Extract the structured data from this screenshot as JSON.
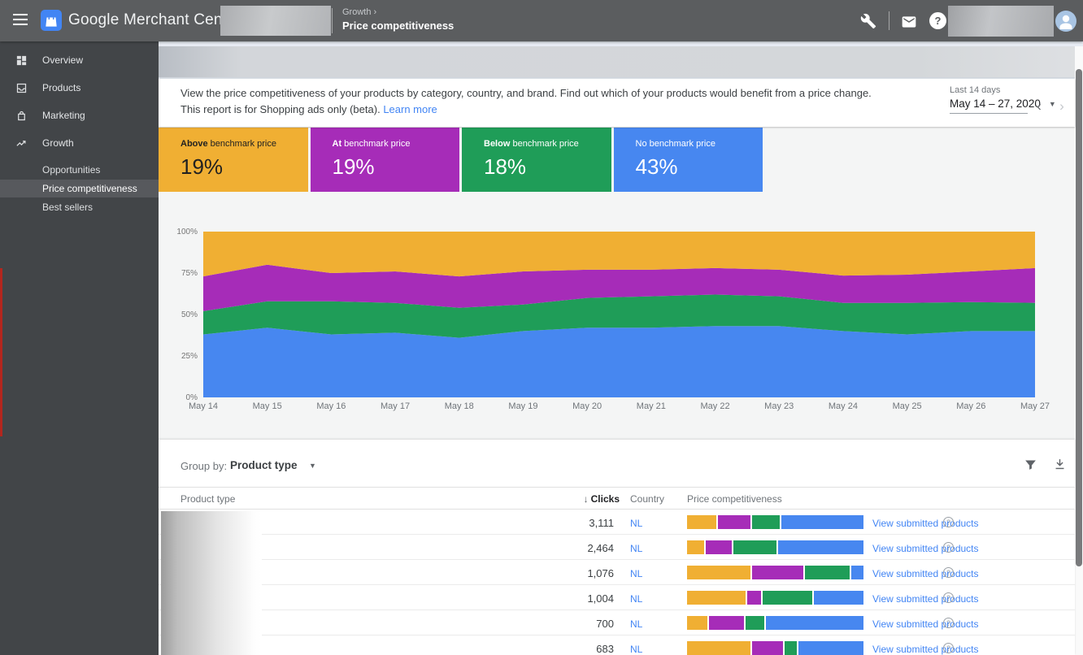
{
  "topbar": {
    "app_title": "Google Merchant Center",
    "breadcrumb": {
      "section": "Growth ›",
      "page": "Price competitiveness"
    }
  },
  "sidebar": {
    "items": [
      {
        "label": "Overview",
        "icon": "dashboard"
      },
      {
        "label": "Products",
        "icon": "products"
      },
      {
        "label": "Marketing",
        "icon": "marketing"
      },
      {
        "label": "Growth",
        "icon": "growth"
      }
    ],
    "sub_items": [
      {
        "label": "Opportunities",
        "selected": false
      },
      {
        "label": "Price competitiveness",
        "selected": true
      },
      {
        "label": "Best sellers",
        "selected": false
      }
    ]
  },
  "intro": {
    "line1": "View the price competitiveness of your products by category, country, and brand. Find out which of your products would benefit from a price change.",
    "line2": "This report is for Shopping ads only (beta).",
    "learn_more_label": "Learn more"
  },
  "date_picker": {
    "label": "Last 14 days",
    "value": "May 14 – 27, 2020"
  },
  "summary_cards": [
    {
      "emphasis": "Above",
      "rest": " benchmark price",
      "value": "19%",
      "color": "#F0AF33",
      "text": "dark"
    },
    {
      "emphasis": "At",
      "rest": " benchmark price",
      "value": "19%",
      "color": "#A62CB8",
      "text": "light"
    },
    {
      "emphasis": "Below",
      "rest": " benchmark price",
      "value": "18%",
      "color": "#1F9D58",
      "text": "light"
    },
    {
      "emphasis": "",
      "rest": "No benchmark price",
      "value": "43%",
      "color": "#4787F0",
      "text": "light"
    }
  ],
  "colors": {
    "above": "#F0AF33",
    "at": "#A62CB8",
    "below": "#1F9D58",
    "no_benchmark": "#4787F0"
  },
  "chart_data": {
    "type": "area",
    "stacked": true,
    "unit": "percent",
    "x": [
      "May 14",
      "May 15",
      "May 16",
      "May 17",
      "May 18",
      "May 19",
      "May 20",
      "May 21",
      "May 22",
      "May 23",
      "May 24",
      "May 25",
      "May 26",
      "May 27"
    ],
    "ylim": [
      0,
      100
    ],
    "yticks": [
      "0%",
      "25%",
      "50%",
      "75%",
      "100%"
    ],
    "grid": false,
    "legend": "none",
    "series": [
      {
        "name": "No benchmark price",
        "color_key": "no_benchmark",
        "values": [
          38,
          42,
          38,
          39,
          36,
          40,
          42,
          42,
          43,
          43,
          40,
          38,
          40,
          40
        ]
      },
      {
        "name": "Below benchmark price",
        "color_key": "below",
        "values": [
          14,
          16,
          20,
          18,
          18,
          16,
          18,
          19,
          19,
          18,
          17,
          19,
          17.5,
          17
        ]
      },
      {
        "name": "At benchmark price",
        "color_key": "at",
        "values": [
          21,
          22,
          17,
          19,
          19,
          20,
          17,
          16,
          16,
          16,
          16.5,
          17,
          18.5,
          21
        ]
      },
      {
        "name": "Above benchmark price",
        "color_key": "above",
        "values": [
          27,
          20,
          25,
          24,
          27,
          24,
          23,
          23,
          22,
          23,
          26.5,
          26,
          24,
          22
        ]
      }
    ]
  },
  "table": {
    "group_by_label": "Group by:",
    "group_by_value": "Product type",
    "columns": {
      "product_type": "Product type",
      "clicks": "Clicks",
      "country": "Country",
      "price_competitiveness": "Price competitiveness"
    },
    "sorted_by": "Clicks",
    "sort_direction": "descending",
    "action_label": "View submitted products",
    "rows": [
      {
        "clicks": "3,111",
        "country": "NL",
        "bar": [
          17,
          19,
          16,
          48
        ]
      },
      {
        "clicks": "2,464",
        "country": "NL",
        "bar": [
          10,
          15,
          25,
          50
        ]
      },
      {
        "clicks": "1,076",
        "country": "NL",
        "bar": [
          37,
          30,
          26,
          7
        ]
      },
      {
        "clicks": "1,004",
        "country": "NL",
        "bar": [
          34,
          8,
          29,
          29
        ]
      },
      {
        "clicks": "700",
        "country": "NL",
        "bar": [
          12,
          20,
          11,
          57
        ]
      },
      {
        "clicks": "683",
        "country": "NL",
        "bar": [
          37,
          18,
          7,
          38
        ]
      }
    ]
  }
}
